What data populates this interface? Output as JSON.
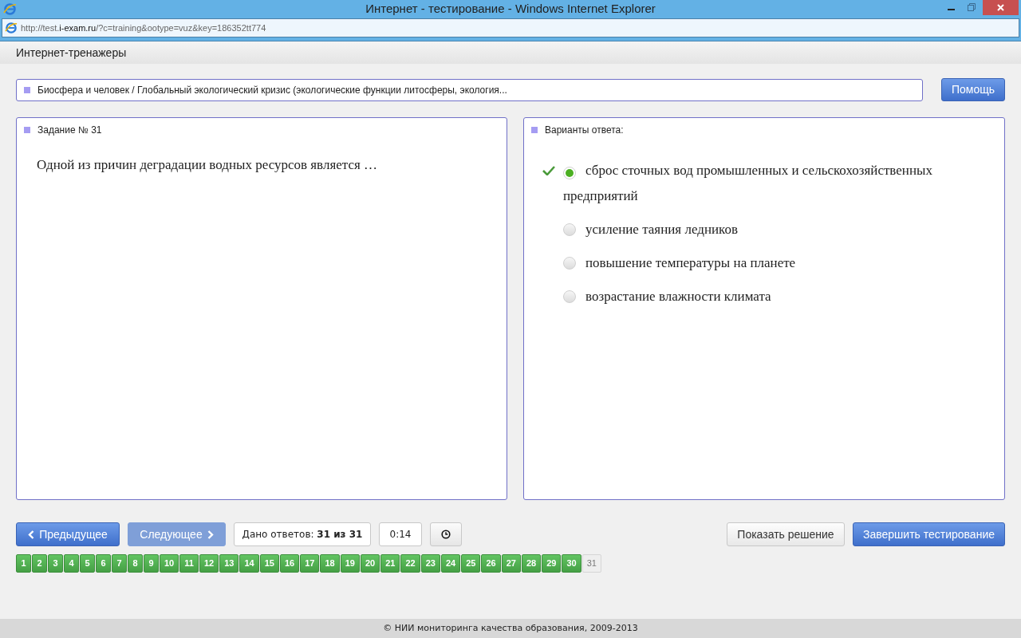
{
  "window": {
    "title": "Интернет - тестирование - Windows Internet Explorer"
  },
  "address": {
    "prefix": "http://test.",
    "domain": "i-exam.ru",
    "path": "/?c=training&ootype=vuz&key=186352tt774"
  },
  "header": {
    "title": "Интернет-тренажеры"
  },
  "topic": "Биосфера и человек / Глобальный экологический кризис (экологические функции литосферы, экология...",
  "help_button": "Помощь",
  "task": {
    "title": "Задание № 31",
    "question": "Одной из причин деградации водных ресурсов является …"
  },
  "answers": {
    "title": "Варианты ответа:",
    "options": [
      {
        "text": "сброс сточных вод промышленных и сельскохозяйственных предприятий",
        "selected": true,
        "correct": true
      },
      {
        "text": "усиление таяния ледников",
        "selected": false,
        "correct": false
      },
      {
        "text": "повышение температуры на планете",
        "selected": false,
        "correct": false
      },
      {
        "text": "возрастание влажности климата",
        "selected": false,
        "correct": false
      }
    ]
  },
  "nav": {
    "prev": "Предыдущее",
    "next": "Следующее",
    "next_disabled": true,
    "answered": "Дано ответов: **31 из 31**",
    "timer": "0:14"
  },
  "actions": {
    "show_solution": "Показать решение",
    "finish": "Завершить тестирование"
  },
  "questions": [
    {
      "label": "1",
      "answered": true
    },
    {
      "label": "2",
      "answered": true
    },
    {
      "label": "3",
      "answered": true
    },
    {
      "label": "4",
      "answered": true
    },
    {
      "label": "5",
      "answered": true
    },
    {
      "label": "6",
      "answered": true
    },
    {
      "label": "7",
      "answered": true
    },
    {
      "label": "8",
      "answered": true
    },
    {
      "label": "9",
      "answered": true
    },
    {
      "label": "10",
      "answered": true
    },
    {
      "label": "11",
      "answered": true
    },
    {
      "label": "12",
      "answered": true
    },
    {
      "label": "13",
      "answered": true
    },
    {
      "label": "14",
      "answered": true
    },
    {
      "label": "15",
      "answered": true
    },
    {
      "label": "16",
      "answered": true
    },
    {
      "label": "17",
      "answered": true
    },
    {
      "label": "18",
      "answered": true
    },
    {
      "label": "19",
      "answered": true
    },
    {
      "label": "20",
      "answered": true
    },
    {
      "label": "21",
      "answered": true
    },
    {
      "label": "22",
      "answered": true
    },
    {
      "label": "23",
      "answered": true
    },
    {
      "label": "24",
      "answered": true
    },
    {
      "label": "25",
      "answered": true
    },
    {
      "label": "26",
      "answered": true
    },
    {
      "label": "27",
      "answered": true
    },
    {
      "label": "28",
      "answered": true
    },
    {
      "label": "29",
      "answered": true
    },
    {
      "label": "30",
      "answered": true
    },
    {
      "label": "31",
      "answered": false
    }
  ],
  "footer": "© НИИ мониторинга качества образования, 2009-2013"
}
